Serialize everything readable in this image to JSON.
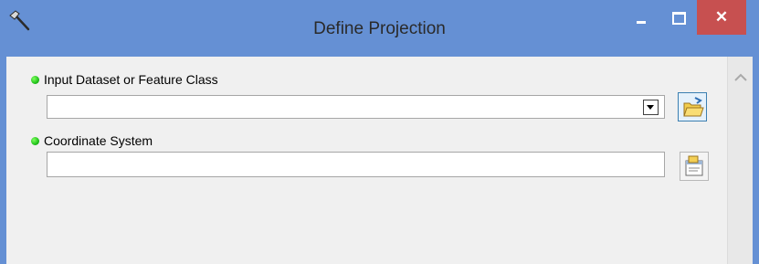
{
  "window": {
    "title": "Define Projection",
    "icons": [
      "tool-hammer-icon",
      "minimize-icon",
      "maximize-icon",
      "close-icon"
    ],
    "colors": {
      "titlebar": "#6590d4",
      "close_button": "#c75050",
      "client": "#f0f0f0"
    }
  },
  "form": {
    "input_dataset": {
      "label": "Input Dataset or Feature Class",
      "value": "",
      "indicator": "green-required-dot",
      "browse_icon": "open-folder-icon"
    },
    "coordinate_system": {
      "label": "Coordinate System",
      "value": "",
      "indicator": "green-required-dot",
      "properties_icon": "spatial-reference-properties-icon"
    }
  }
}
